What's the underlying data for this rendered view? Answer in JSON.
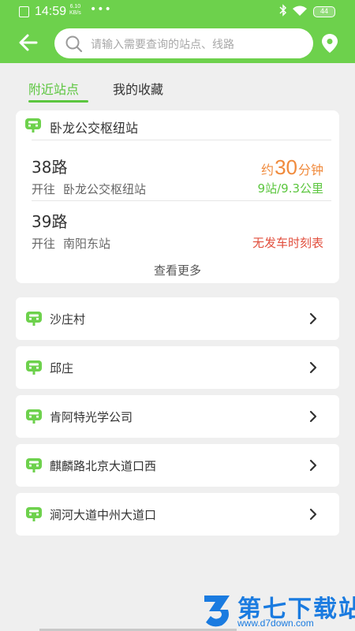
{
  "status_bar": {
    "time": "14:59",
    "net_speed_value": "6.10",
    "net_speed_unit": "KB/s",
    "more": "•••",
    "battery": "44"
  },
  "header": {
    "search_placeholder": "请输入需要查询的站点、线路",
    "accent_color": "#6dd14c"
  },
  "tabs": [
    {
      "label": "附近站点",
      "active": true
    },
    {
      "label": "我的收藏",
      "active": false
    }
  ],
  "nearby_card": {
    "station_name": "卧龙公交枢纽站",
    "routes": [
      {
        "name": "38路",
        "direction_prefix": "开往",
        "destination": "卧龙公交枢纽站",
        "eta_prefix": "约",
        "eta_value": "30",
        "eta_unit": "分钟",
        "distance": "9站/9.3公里"
      },
      {
        "name": "39路",
        "direction_prefix": "开往",
        "destination": "南阳东站",
        "status": "无发车时刻表"
      }
    ],
    "more_label": "查看更多"
  },
  "stations": [
    {
      "name": "沙庄村"
    },
    {
      "name": "邱庄"
    },
    {
      "name": "肯阿特光学公司"
    },
    {
      "name": "麒麟路北京大道口西"
    },
    {
      "name": "涧河大道中州大道口"
    }
  ],
  "watermark": {
    "title": "第七下载站",
    "url": "www.d7down.com"
  }
}
